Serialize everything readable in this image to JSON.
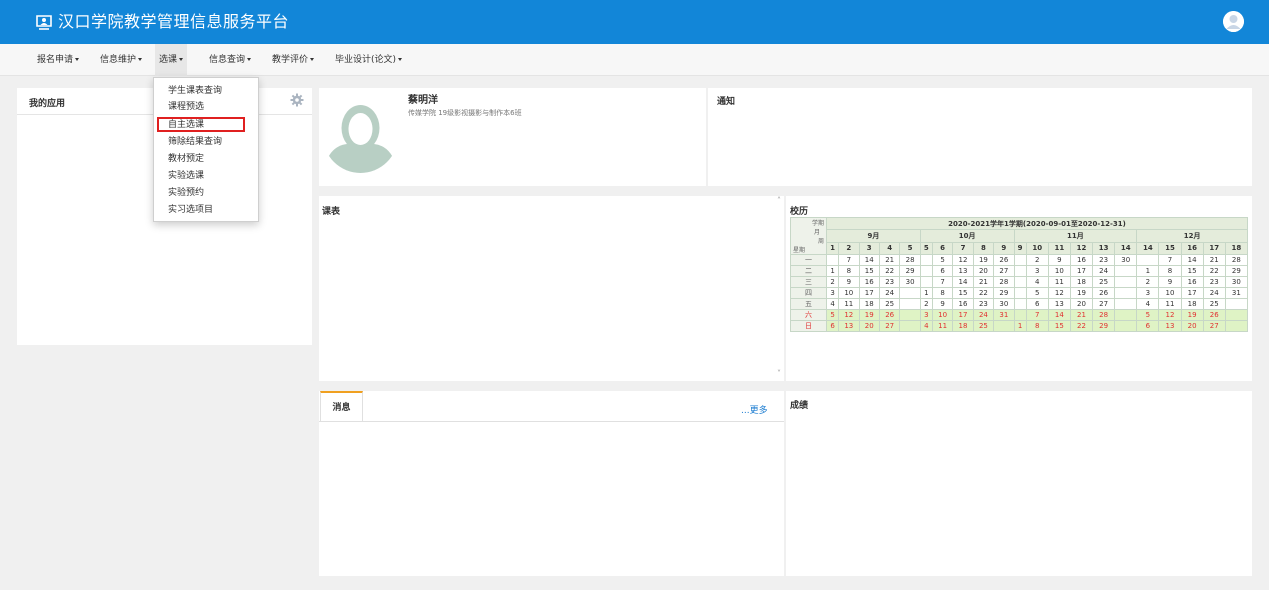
{
  "header": {
    "title": "汉口学院教学管理信息服务平台"
  },
  "nav": {
    "items": [
      {
        "label": "报名申请"
      },
      {
        "label": "信息维护"
      },
      {
        "label": "选课"
      },
      {
        "label": "信息查询"
      },
      {
        "label": "教学评价"
      },
      {
        "label": "毕业设计(论文)"
      }
    ],
    "dropdown": [
      "学生课表查询",
      "课程预选",
      "自主选课",
      "筛除结果查询",
      "教材预定",
      "实验选课",
      "实验预约",
      "实习选项目"
    ]
  },
  "apps": {
    "title": "我的应用"
  },
  "profile": {
    "name": "蔡明洋",
    "dept": "传媒学院 19级影视摄影与制作本6班"
  },
  "notice": {
    "title": "通知"
  },
  "schedule": {
    "title": "课表",
    "scroll_up": "˄",
    "scroll_down": "˅"
  },
  "calendar": {
    "title": "校历",
    "corner": {
      "term": "学期",
      "month": "月",
      "week": "周",
      "weekday": "星期"
    },
    "term_label": "2020-2021学年1学期(2020-09-01至2020-12-31)",
    "months": [
      "9月",
      "10月",
      "11月",
      "12月"
    ],
    "weeks": [
      "1",
      "2",
      "3",
      "4",
      "5",
      "5",
      "6",
      "7",
      "8",
      "9",
      "9",
      "10",
      "11",
      "12",
      "13",
      "14",
      "14",
      "15",
      "16",
      "17",
      "18"
    ],
    "rows": [
      {
        "day": "一",
        "cells": [
          "",
          "7",
          "14",
          "21",
          "28",
          "",
          "5",
          "12",
          "19",
          "26",
          "",
          "2",
          "9",
          "16",
          "23",
          "30",
          "",
          "7",
          "14",
          "21",
          "28"
        ]
      },
      {
        "day": "二",
        "cells": [
          "1",
          "8",
          "15",
          "22",
          "29",
          "",
          "6",
          "13",
          "20",
          "27",
          "",
          "3",
          "10",
          "17",
          "24",
          "",
          "1",
          "8",
          "15",
          "22",
          "29"
        ]
      },
      {
        "day": "三",
        "cells": [
          "2",
          "9",
          "16",
          "23",
          "30",
          "",
          "7",
          "14",
          "21",
          "28",
          "",
          "4",
          "11",
          "18",
          "25",
          "",
          "2",
          "9",
          "16",
          "23",
          "30"
        ]
      },
      {
        "day": "四",
        "cells": [
          "3",
          "10",
          "17",
          "24",
          "",
          "1",
          "8",
          "15",
          "22",
          "29",
          "",
          "5",
          "12",
          "19",
          "26",
          "",
          "3",
          "10",
          "17",
          "24",
          "31"
        ]
      },
      {
        "day": "五",
        "cells": [
          "4",
          "11",
          "18",
          "25",
          "",
          "2",
          "9",
          "16",
          "23",
          "30",
          "",
          "6",
          "13",
          "20",
          "27",
          "",
          "4",
          "11",
          "18",
          "25",
          ""
        ]
      },
      {
        "day": "六",
        "cells": [
          "5",
          "12",
          "19",
          "26",
          "",
          "3",
          "10",
          "17",
          "24",
          "31",
          "",
          "7",
          "14",
          "21",
          "28",
          "",
          "5",
          "12",
          "19",
          "26",
          ""
        ]
      },
      {
        "day": "日",
        "cells": [
          "6",
          "13",
          "20",
          "27",
          "",
          "4",
          "11",
          "18",
          "25",
          "",
          "1",
          "8",
          "15",
          "22",
          "29",
          "",
          "6",
          "13",
          "20",
          "27",
          ""
        ]
      }
    ],
    "weekend_color": "#e03030",
    "weekend_bg": "#dff3c5"
  },
  "messages": {
    "tab": "消息",
    "more": "...更多"
  },
  "grades": {
    "title": "成绩"
  },
  "colors": {
    "brand": "#1286d8",
    "highlight": "#e02020",
    "tab_accent": "#f0a020"
  }
}
